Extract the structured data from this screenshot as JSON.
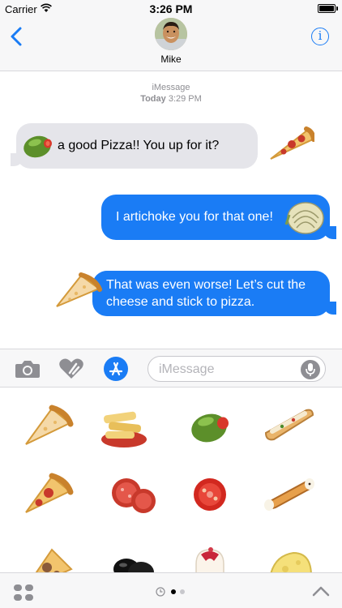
{
  "status_bar": {
    "carrier": "Carrier",
    "time": "3:26 PM"
  },
  "header": {
    "contact_name": "Mike",
    "info_glyph": "i",
    "back_icon": "chevron-left-icon"
  },
  "thread": {
    "service": "iMessage",
    "day": "Today",
    "time": "3:29 PM"
  },
  "messages": [
    {
      "direction": "incoming",
      "text": "a good Pizza!! You up for it?",
      "sticker": "olive"
    },
    {
      "direction": "outgoing",
      "text": "I artichoke you for that one!",
      "sticker": "artichoke"
    },
    {
      "direction": "outgoing",
      "line1": "That was even worse! Let’s cut the",
      "line2": "cheese and stick to pizza.",
      "sticker": "pizza-slice"
    }
  ],
  "compose": {
    "placeholder": "iMessage"
  },
  "stickers": [
    "pizza-slice",
    "penne-pasta",
    "olive",
    "bruschetta",
    "pepperoni-pizza-slice",
    "pepperoni-slices",
    "tomato-slice",
    "cannoli",
    "meatball-pizza",
    "black-olives",
    "panna-cotta",
    "cheese-slice"
  ],
  "drawer": {
    "page_count": 2,
    "current_page": 1
  },
  "colors": {
    "imessage_blue": "#1a7cf5",
    "incoming_gray": "#e5e5ea",
    "bar_background": "#f7f7f8"
  }
}
